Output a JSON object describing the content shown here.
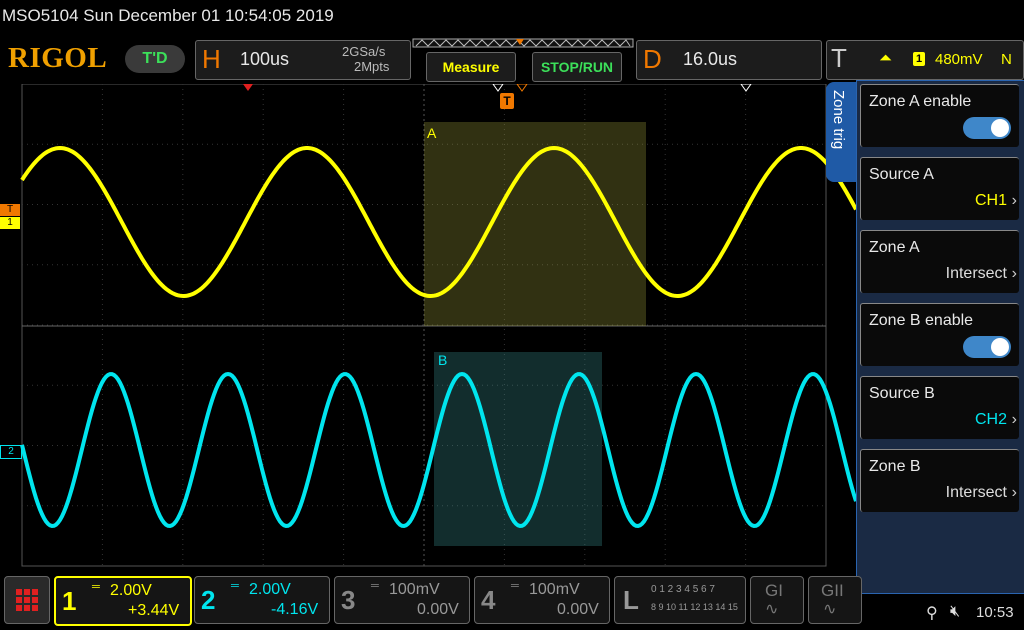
{
  "title": "MSO5104  Sun December 01 10:54:05 2019",
  "logo": "RIGOL",
  "mode": "T'D",
  "horizontal": {
    "letter": "H",
    "timebase": "100us",
    "sample_rate": "2GSa/s",
    "memory": "2Mpts"
  },
  "buttons": {
    "measure": "Measure",
    "stop_run": "STOP/RUN"
  },
  "delay": {
    "letter": "D",
    "value": "16.0us"
  },
  "trigger": {
    "letter": "T",
    "channel": "1",
    "level": "480mV",
    "mode": "N"
  },
  "zones": {
    "a_label": "A",
    "b_label": "B"
  },
  "markers": {
    "trigger": "T",
    "ch1": "1",
    "ch2": "2"
  },
  "side_tab": "Zone trig",
  "menu": [
    {
      "label": "Zone A enable",
      "type": "toggle",
      "value": true
    },
    {
      "label": "Source A",
      "value": "CH1"
    },
    {
      "label": "Zone A",
      "value": "Intersect"
    },
    {
      "label": "Zone B enable",
      "type": "toggle",
      "value": true
    },
    {
      "label": "Source B",
      "value": "CH2"
    },
    {
      "label": "Zone B",
      "value": "Intersect"
    }
  ],
  "channels": [
    {
      "num": "1",
      "scale": "2.00V",
      "offset": "+3.44V",
      "color": "#ffff00"
    },
    {
      "num": "2",
      "scale": "2.00V",
      "offset": "-4.16V",
      "color": "#00e5ee"
    },
    {
      "num": "3",
      "scale": "100mV",
      "offset": "0.00V",
      "color": "#888888"
    },
    {
      "num": "4",
      "scale": "100mV",
      "offset": "0.00V",
      "color": "#888888"
    }
  ],
  "logic": {
    "letter": "L",
    "row1": "0 1 2 3  4 5 6 7",
    "row2": "8 9 10 11 12 13 14 15"
  },
  "decoders": {
    "g1": "GI",
    "g2": "GII"
  },
  "status": {
    "time": "10:53"
  },
  "colors": {
    "ch1": "#ffff00",
    "ch2": "#00e5ee",
    "accent": "#f07800",
    "panel": "#1f5aa6"
  }
}
